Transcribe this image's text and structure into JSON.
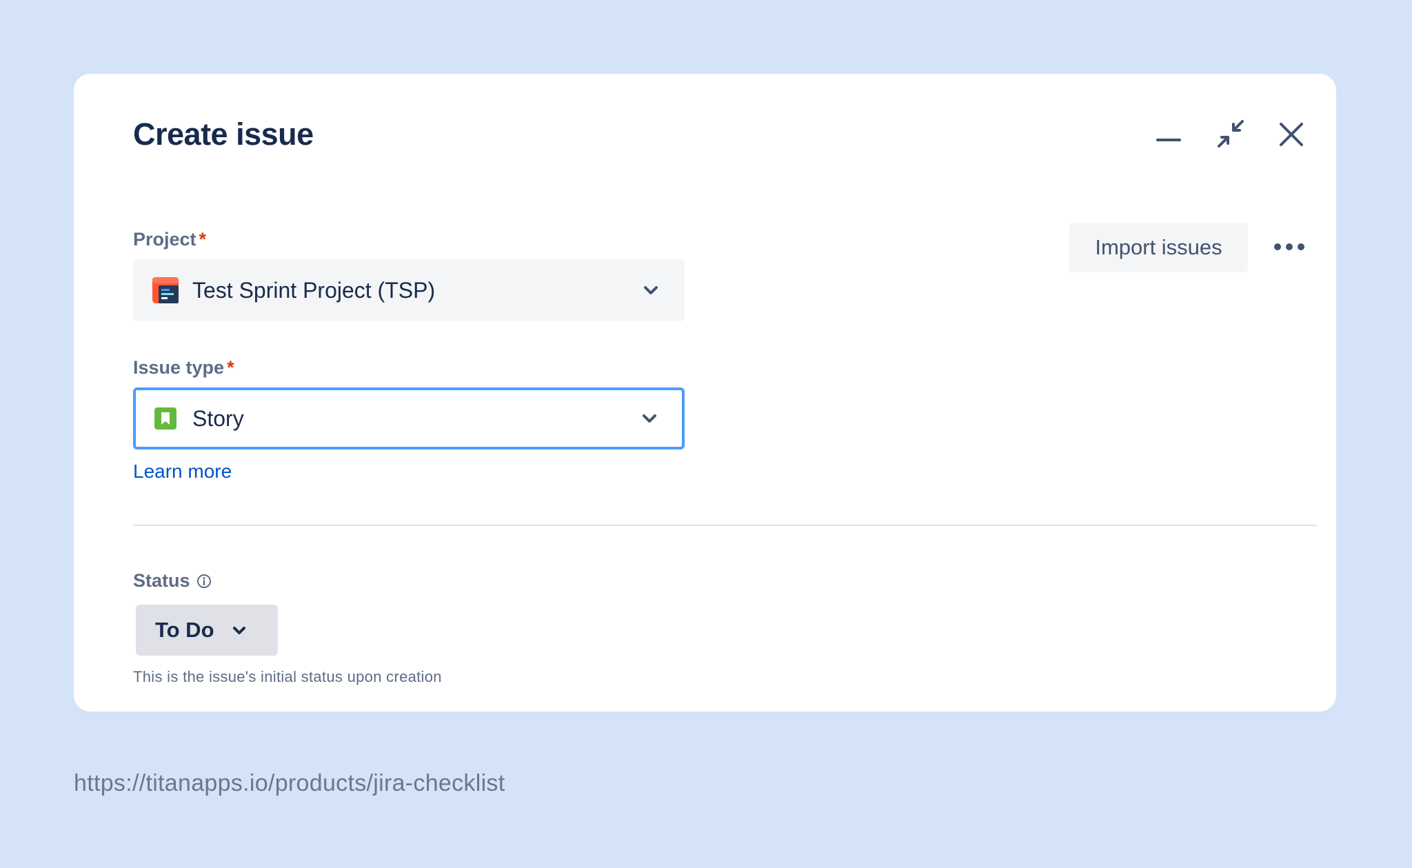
{
  "dialog": {
    "title": "Create issue",
    "controls": {
      "minimize_icon": "minimize-icon",
      "collapse_icon": "collapse-icon",
      "close_icon": "close-icon"
    }
  },
  "toolbar": {
    "import_label": "Import issues",
    "more_icon": "more-horizontal-icon"
  },
  "fields": {
    "project": {
      "label": "Project",
      "required_mark": "*",
      "value": "Test Sprint Project (TSP)",
      "icon": "project-avatar-icon"
    },
    "issue_type": {
      "label": "Issue type",
      "required_mark": "*",
      "value": "Story",
      "icon": "story-icon",
      "learn_more": "Learn more"
    },
    "status": {
      "label": "Status",
      "value": "To Do",
      "helper": "This is the issue's initial status upon creation",
      "icon": "info-icon"
    }
  },
  "footer": {
    "url": "https://titanapps.io/products/jira-checklist"
  },
  "colors": {
    "background": "#d4e3f8",
    "title": "#172b4d",
    "label": "#5e6c84",
    "required": "#de350b",
    "link": "#0052cc",
    "focus_border": "#4c9aff",
    "story_green": "#63ba3c",
    "project_red": "#ff5630"
  }
}
